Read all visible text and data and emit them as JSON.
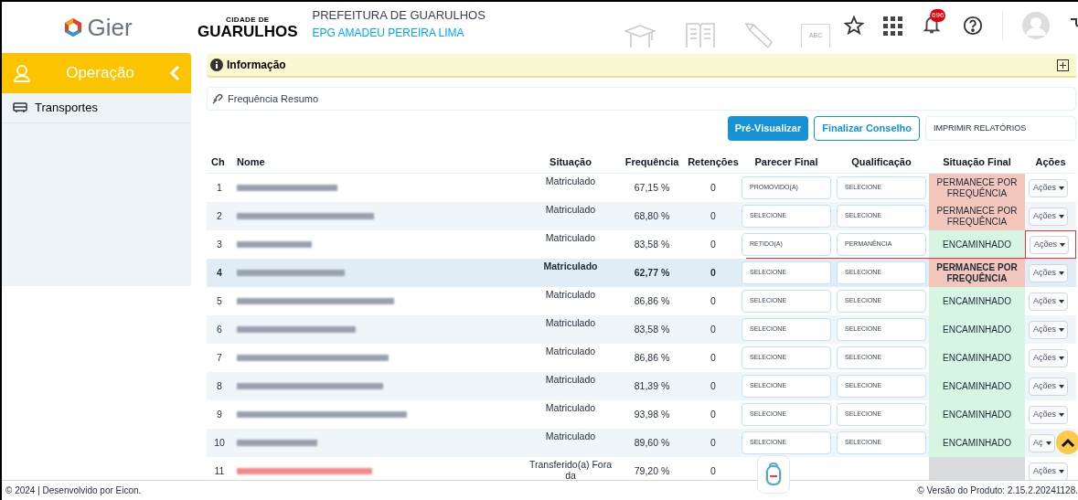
{
  "header": {
    "brand": "Gier",
    "city_small": "CIDADE DE",
    "city_big": "GUARULHOS",
    "title": "PREFEITURA DE GUARULHOS",
    "subtitle": "EPG AMADEU PEREIRA LIMA",
    "board_label": "ABC",
    "notifications": "696"
  },
  "sidebar": {
    "title": "Operação",
    "items": [
      {
        "label": "Transportes",
        "selected": false
      }
    ]
  },
  "info_bar": {
    "title": "Informação"
  },
  "breadcrumb": "Frequência Resumo",
  "buttons": [
    {
      "label": "Pré-Visualizar",
      "kind": "primary"
    },
    {
      "label": "Finalizar Conselho",
      "kind": "outline"
    },
    {
      "label": "IMPRIMIR RELATÓRIOS",
      "kind": "plain"
    }
  ],
  "table": {
    "columns": [
      "Ch",
      "Nome",
      "Situação",
      "Frequência",
      "Retenções",
      "Parecer Final",
      "Qualificação",
      "Situação Final",
      "Ações"
    ],
    "rows": [
      {
        "ch": "1",
        "selected": false,
        "flagged": false,
        "name_alert": false,
        "situacao": "Matriculado",
        "frequencia": "67,15 %",
        "retencoes": "0",
        "parecer": "PROMOVIDO(A)",
        "qualificacao": "SELECIONE",
        "final": {
          "kind": "warning",
          "text": "PERMANECE POR FREQUÊNCIA"
        },
        "acoes": "Ações"
      },
      {
        "ch": "2",
        "selected": false,
        "flagged": false,
        "name_alert": false,
        "situacao": "Matriculado",
        "frequencia": "68,80 %",
        "retencoes": "0",
        "parecer": "SELECIONE",
        "qualificacao": "SELECIONE",
        "final": {
          "kind": "warning",
          "text": "PERMANECE POR FREQUÊNCIA"
        },
        "acoes": "Ações"
      },
      {
        "ch": "3",
        "selected": false,
        "flagged": true,
        "name_alert": false,
        "situacao": "Matriculado",
        "frequencia": "83,58 %",
        "retencoes": "0",
        "parecer": "RETIDO(A)",
        "qualificacao": "PERMANÊNCIA",
        "final": {
          "kind": "ok",
          "text": "ENCAMINHADO"
        },
        "acoes": "Ações"
      },
      {
        "ch": "4",
        "selected": true,
        "flagged": false,
        "name_alert": false,
        "situacao": "Matriculado",
        "frequencia": "62,77 %",
        "retencoes": "0",
        "parecer": "SELECIONE",
        "qualificacao": "SELECIONE",
        "final": {
          "kind": "warning",
          "text": "PERMANECE POR FREQUÊNCIA"
        },
        "acoes": "Ações"
      },
      {
        "ch": "5",
        "selected": false,
        "flagged": false,
        "name_alert": false,
        "situacao": "Matriculado",
        "frequencia": "86,86 %",
        "retencoes": "0",
        "parecer": "SELECIONE",
        "qualificacao": "SELECIONE",
        "final": {
          "kind": "ok",
          "text": "ENCAMINHADO"
        },
        "acoes": "Ações"
      },
      {
        "ch": "6",
        "selected": false,
        "flagged": false,
        "name_alert": false,
        "situacao": "Matriculado",
        "frequencia": "83,58 %",
        "retencoes": "0",
        "parecer": "SELECIONE",
        "qualificacao": "SELECIONE",
        "final": {
          "kind": "ok",
          "text": "ENCAMINHADO"
        },
        "acoes": "Ações"
      },
      {
        "ch": "7",
        "selected": false,
        "flagged": false,
        "name_alert": false,
        "situacao": "Matriculado",
        "frequencia": "86,86 %",
        "retencoes": "0",
        "parecer": "SELECIONE",
        "qualificacao": "SELECIONE",
        "final": {
          "kind": "ok",
          "text": "ENCAMINHADO"
        },
        "acoes": "Ações"
      },
      {
        "ch": "8",
        "selected": false,
        "flagged": false,
        "name_alert": false,
        "situacao": "Matriculado",
        "frequencia": "81,39 %",
        "retencoes": "0",
        "parecer": "SELECIONE",
        "qualificacao": "SELECIONE",
        "final": {
          "kind": "ok",
          "text": "ENCAMINHADO"
        },
        "acoes": "Ações"
      },
      {
        "ch": "9",
        "selected": false,
        "flagged": false,
        "name_alert": false,
        "situacao": "Matriculado",
        "frequencia": "93,98 %",
        "retencoes": "0",
        "parecer": "SELECIONE",
        "qualificacao": "SELECIONE",
        "final": {
          "kind": "ok",
          "text": "ENCAMINHADO"
        },
        "acoes": "Ações"
      },
      {
        "ch": "10",
        "selected": false,
        "flagged": false,
        "name_alert": false,
        "situacao": "Matriculado",
        "frequencia": "89,60 %",
        "retencoes": "0",
        "parecer": "SELECIONE",
        "qualificacao": "SELECIONE",
        "final": {
          "kind": "ok",
          "text": "ENCAMINHADO"
        },
        "acoes": "Aç"
      },
      {
        "ch": "11",
        "selected": false,
        "flagged": false,
        "name_alert": true,
        "situacao": "Transferido(a) Fora da",
        "frequencia": "79,20 %",
        "retencoes": "0",
        "final": {
          "kind": "empty"
        },
        "acoes": "Ações"
      }
    ]
  },
  "footer": {
    "left": "© 2024 | Desenvolvido por Eicon.",
    "right": "© Versão do Produto: 2.15.2.20241128."
  }
}
